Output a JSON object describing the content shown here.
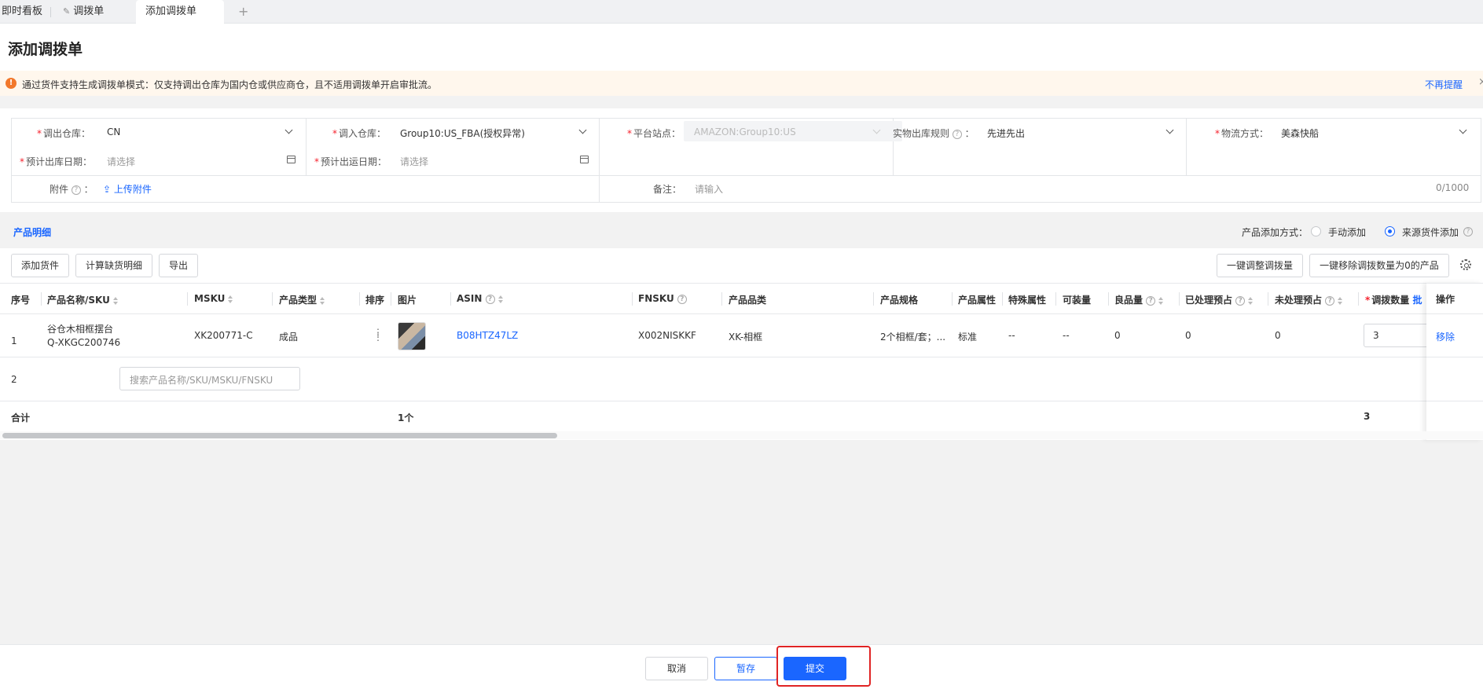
{
  "tabs": [
    {
      "label": "即时看板"
    },
    {
      "label": "调拨单"
    },
    {
      "label": "添加调拨单"
    }
  ],
  "tab_add": "+",
  "page_title": "添加调拨单",
  "alert": {
    "icon": "!",
    "text": "通过货件支持生成调拨单模式：仅支持调出仓库为国内仓或供应商仓，且不适用调拨单开启审批流。",
    "dismiss_link": "不再提醒",
    "close": "×"
  },
  "form": {
    "out_warehouse": {
      "label": "调出仓库：",
      "value": "CN"
    },
    "in_warehouse": {
      "label": "调入仓库：",
      "value": "Group10:US_FBA(授权异常)"
    },
    "platform_site": {
      "label": "平台站点：",
      "value": "AMAZON:Group10:US"
    },
    "outbound_rule": {
      "label": "实物出库规则",
      "value": "先进先出"
    },
    "logistics": {
      "label": "物流方式：",
      "value": "美森快船"
    },
    "est_out_date": {
      "label": "预计出库日期：",
      "placeholder": "请选择"
    },
    "est_ship_date": {
      "label": "预计出运日期：",
      "placeholder": "请选择"
    },
    "attachment": {
      "label": "附件",
      "upload": "上传附件"
    },
    "remark": {
      "label": "备注：",
      "placeholder": "请输入",
      "counter": "0/1000"
    },
    "required_mark": "*",
    "qmark": "?"
  },
  "product_section": {
    "title": "产品明细",
    "add_mode_label": "产品添加方式：",
    "mode_manual": "手动添加",
    "mode_shipment": "来源货件添加",
    "selected_mode": "来源货件添加"
  },
  "toolbar": {
    "add_shipment": "添加货件",
    "calc_shortage": "计算缺货明细",
    "export": "导出",
    "adjust_qty": "一键调整调拨量",
    "remove_zero": "一键移除调拨数量为0的产品"
  },
  "table": {
    "columns": [
      "序号",
      "产品名称/SKU",
      "MSKU",
      "产品类型",
      "排序",
      "图片",
      "ASIN",
      "FNSKU",
      "产品品类",
      "产品规格",
      "产品属性",
      "特殊属性",
      "可装量",
      "良品量",
      "已处理预占",
      "未处理预占",
      "调拨数量",
      "操作"
    ],
    "qty_batch": "批",
    "rows": [
      {
        "index": "1",
        "name": "谷仓木相框摆台",
        "sku": "Q-XKGC200746",
        "msku": "XK200771-C",
        "type": "成品",
        "asin": "B08HTZ47LZ",
        "fnsku": "X002NISKKF",
        "category": "XK-相框",
        "spec": "2个相框/套；...",
        "attr": "标准",
        "special": "--",
        "capacity": "--",
        "good_qty": "0",
        "processed": "0",
        "unprocessed": "0",
        "transfer_qty": "3",
        "action": "移除"
      }
    ],
    "new_row_index": "2",
    "search_placeholder": "搜索产品名称/SKU/MSKU/FNSKU",
    "total_label": "合计",
    "total_count": "1个",
    "total_qty": "3"
  },
  "footer": {
    "cancel": "取消",
    "save_draft": "暂存",
    "submit": "提交"
  },
  "colors": {
    "primary": "#1a66ff",
    "warning": "#f2782b",
    "highlight": "#e02424"
  }
}
